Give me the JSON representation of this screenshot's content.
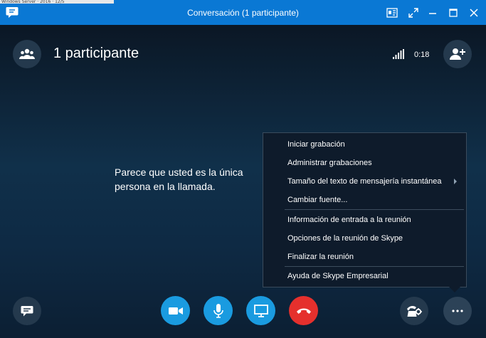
{
  "window": {
    "title": "Conversación (1 participante)",
    "accent_color": "#0a78d4",
    "overlay_text": "Windows Server · 2016 · 12/5"
  },
  "header": {
    "participants_label": "1 participante",
    "call_duration": "0:18"
  },
  "stage": {
    "message": "Parece que usted es la única persona en la llamada."
  },
  "menu": {
    "items": [
      {
        "label": "Iniciar grabación"
      },
      {
        "label": "Administrar grabaciones"
      },
      {
        "label": "Tamaño del texto de mensajería instantánea",
        "has_submenu": true
      },
      {
        "label": "Cambiar fuente..."
      },
      {
        "label": "Información de entrada a la reunión"
      },
      {
        "label": "Opciones de la reunión de Skype"
      },
      {
        "label": "Finalizar la reunión"
      },
      {
        "label": "Ayuda de Skype Empresarial"
      }
    ]
  },
  "controls": {
    "im_icon": "chat-bubble-icon",
    "video_icon": "video-camera-icon",
    "mic_icon": "microphone-icon",
    "present_icon": "monitor-icon",
    "hangup_icon": "hang-up-icon",
    "call_controls_icon": "phone-settings-icon",
    "more_icon": "more-options-icon",
    "hangup_color": "#e5302d",
    "action_color": "#1a9be0"
  }
}
